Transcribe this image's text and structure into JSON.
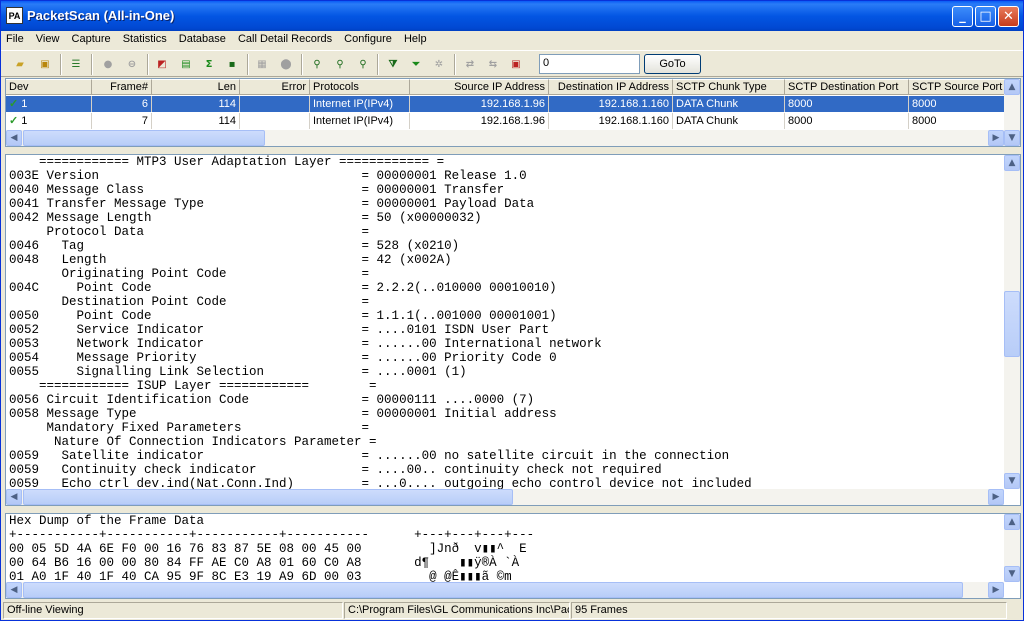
{
  "window": {
    "title": "PacketScan (All-in-One)",
    "app_icon_text": "PA",
    "minimize": "_",
    "maximize": "□",
    "close": "✕"
  },
  "menu": [
    "File",
    "View",
    "Capture",
    "Statistics",
    "Database",
    "Call Detail Records",
    "Configure",
    "Help"
  ],
  "toolbar": {
    "frame_value": "0",
    "goto_label": "GoTo"
  },
  "packet_list": {
    "columns": [
      "Dev",
      "Frame#",
      "Len",
      "Error",
      "Protocols",
      "Source IP Address",
      "Destination IP Address",
      "SCTP Chunk Type",
      "SCTP Destination Port",
      "SCTP Source Port"
    ],
    "rows": [
      {
        "dev": "1",
        "frame": "6",
        "len": "114",
        "error": "",
        "protocols": "Internet IP(IPv4)",
        "src": "192.168.1.96",
        "dst": "192.168.1.160",
        "chunk": "DATA Chunk",
        "dport": "8000",
        "sport": "8000"
      },
      {
        "dev": "1",
        "frame": "7",
        "len": "114",
        "error": "",
        "protocols": "Internet IP(IPv4)",
        "src": "192.168.1.96",
        "dst": "192.168.1.160",
        "chunk": "DATA Chunk",
        "dport": "8000",
        "sport": "8000"
      }
    ]
  },
  "decode_lines": [
    "    ============ MTP3 User Adaptation Layer ============ =",
    "003E Version                                   = 00000001 Release 1.0",
    "0040 Message Class                             = 00000001 Transfer",
    "0041 Transfer Message Type                     = 00000001 Payload Data",
    "0042 Message Length                            = 50 (x00000032)",
    "     Protocol Data                             =",
    "0046   Tag                                     = 528 (x0210)",
    "0048   Length                                  = 42 (x002A)",
    "       Originating Point Code                  =",
    "004C     Point Code                            = 2.2.2(..010000 00010010)",
    "       Destination Point Code                  =",
    "0050     Point Code                            = 1.1.1(..001000 00001001)",
    "0052     Service Indicator                     = ....0101 ISDN User Part",
    "0053     Network Indicator                     = ......00 International network",
    "0054     Message Priority                      = ......00 Priority Code 0",
    "0055     Signalling Link Selection             = ....0001 (1)",
    "    ============ ISUP Layer ============        =",
    "0056 Circuit Identification Code               = 00000111 ....0000 (7)",
    "0058 Message Type                              = 00000001 Initial address",
    "     Mandatory Fixed Parameters                =",
    "      Nature Of Connection Indicators Parameter =",
    "0059   Satellite indicator                     = ......00 no satellite circuit in the connection",
    "0059   Continuity check indicator              = ....00.. continuity check not required",
    "0059   Echo ctrl dev.ind(Nat.Conn.Ind)         = ...0.... outgoing echo control device not included"
  ],
  "hex_lines": [
    "Hex Dump of the Frame Data",
    "+-----------+-----------+-----------+-----------      +---+---+---+---",
    "00 05 5D 4A 6E F0 00 16 76 83 87 5E 08 00 45 00         ]Jnð  v▮▮^  E",
    "00 64 B6 16 00 00 80 84 FF AE C0 A8 01 60 C0 A8       d¶    ▮▮ÿ®À `À",
    "01 A0 1F 40 1F 40 CA 95 9F 8C E3 19 A9 6D 00 03         @ @Ê▮▮▮ã ©m"
  ],
  "status": {
    "mode": "Off-line Viewing",
    "path": "C:\\Program Files\\GL Communications Inc\\Packe",
    "frames": "95 Frames"
  }
}
